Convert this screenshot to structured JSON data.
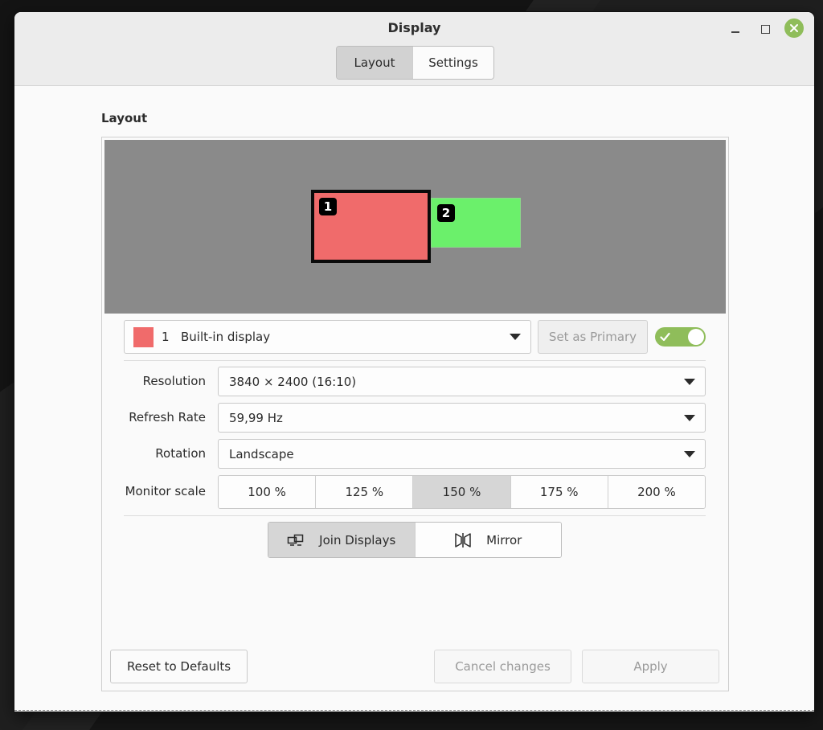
{
  "window": {
    "title": "Display"
  },
  "tabs": [
    {
      "label": "Layout",
      "active": true
    },
    {
      "label": "Settings",
      "active": false
    }
  ],
  "section": {
    "label": "Layout"
  },
  "monitors": [
    {
      "number": "1",
      "color": "#f06b6b"
    },
    {
      "number": "2",
      "color": "#6bf06b"
    }
  ],
  "display_select": {
    "number": "1",
    "name": "Built-in display"
  },
  "set_primary": {
    "label": "Set as Primary"
  },
  "enabled_toggle": {
    "on": true
  },
  "settings": {
    "resolution": {
      "label": "Resolution",
      "value": "3840 × 2400 (16:10)"
    },
    "refresh_rate": {
      "label": "Refresh Rate",
      "value": "59,99 Hz"
    },
    "rotation": {
      "label": "Rotation",
      "value": "Landscape"
    },
    "monitor_scale": {
      "label": "Monitor scale",
      "options": [
        "100 %",
        "125 %",
        "150 %",
        "175 %",
        "200 %"
      ],
      "selected": "150 %"
    }
  },
  "modes": {
    "join": {
      "label": "Join Displays",
      "icon": "join-displays-icon",
      "active": true
    },
    "mirror": {
      "label": "Mirror",
      "icon": "mirror-icon",
      "active": false
    }
  },
  "buttons": {
    "reset": "Reset to Defaults",
    "cancel": "Cancel changes",
    "apply": "Apply"
  },
  "colors": {
    "accent": "#8fbd5a"
  }
}
